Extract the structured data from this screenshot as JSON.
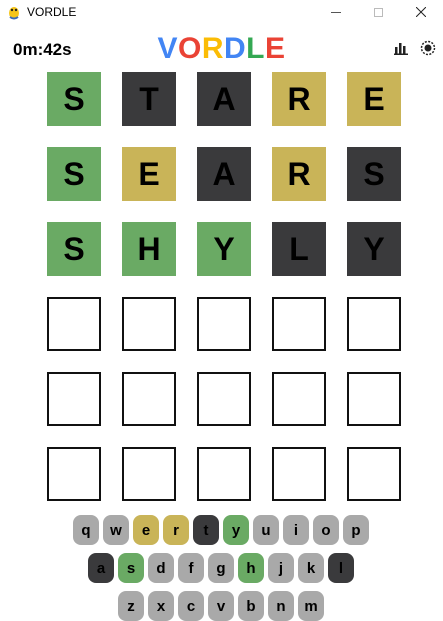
{
  "window": {
    "title": "VORDLE",
    "icon": "pygame-snake-icon"
  },
  "header": {
    "timer": "0m:42s",
    "logo_letters": [
      {
        "ch": "V",
        "color": "#4285f4"
      },
      {
        "ch": "O",
        "color": "#ea4335"
      },
      {
        "ch": "R",
        "color": "#fbbc05"
      },
      {
        "ch": "D",
        "color": "#4285f4"
      },
      {
        "ch": "L",
        "color": "#34a853"
      },
      {
        "ch": "E",
        "color": "#ea4335"
      }
    ],
    "stats_icon": "bar-chart-icon",
    "settings_icon": "gear-icon"
  },
  "board": {
    "rows": [
      [
        {
          "l": "S",
          "s": "green"
        },
        {
          "l": "T",
          "s": "gray"
        },
        {
          "l": "A",
          "s": "gray"
        },
        {
          "l": "R",
          "s": "yellow"
        },
        {
          "l": "E",
          "s": "yellow"
        }
      ],
      [
        {
          "l": "S",
          "s": "green"
        },
        {
          "l": "E",
          "s": "yellow"
        },
        {
          "l": "A",
          "s": "gray"
        },
        {
          "l": "R",
          "s": "yellow"
        },
        {
          "l": "S",
          "s": "gray"
        }
      ],
      [
        {
          "l": "S",
          "s": "green"
        },
        {
          "l": "H",
          "s": "green"
        },
        {
          "l": "Y",
          "s": "green"
        },
        {
          "l": "L",
          "s": "gray"
        },
        {
          "l": "Y",
          "s": "gray"
        }
      ],
      [
        {
          "l": "",
          "s": "empty"
        },
        {
          "l": "",
          "s": "empty"
        },
        {
          "l": "",
          "s": "empty"
        },
        {
          "l": "",
          "s": "empty"
        },
        {
          "l": "",
          "s": "empty"
        }
      ],
      [
        {
          "l": "",
          "s": "empty"
        },
        {
          "l": "",
          "s": "empty"
        },
        {
          "l": "",
          "s": "empty"
        },
        {
          "l": "",
          "s": "empty"
        },
        {
          "l": "",
          "s": "empty"
        }
      ],
      [
        {
          "l": "",
          "s": "empty"
        },
        {
          "l": "",
          "s": "empty"
        },
        {
          "l": "",
          "s": "empty"
        },
        {
          "l": "",
          "s": "empty"
        },
        {
          "l": "",
          "s": "empty"
        }
      ]
    ]
  },
  "keyboard": {
    "rows": [
      [
        {
          "k": "q",
          "s": "unused"
        },
        {
          "k": "w",
          "s": "unused"
        },
        {
          "k": "e",
          "s": "yellow"
        },
        {
          "k": "r",
          "s": "yellow"
        },
        {
          "k": "t",
          "s": "gray"
        },
        {
          "k": "y",
          "s": "green"
        },
        {
          "k": "u",
          "s": "unused"
        },
        {
          "k": "i",
          "s": "unused"
        },
        {
          "k": "o",
          "s": "unused"
        },
        {
          "k": "p",
          "s": "unused"
        }
      ],
      [
        {
          "k": "a",
          "s": "gray"
        },
        {
          "k": "s",
          "s": "green"
        },
        {
          "k": "d",
          "s": "unused"
        },
        {
          "k": "f",
          "s": "unused"
        },
        {
          "k": "g",
          "s": "unused"
        },
        {
          "k": "h",
          "s": "green"
        },
        {
          "k": "j",
          "s": "unused"
        },
        {
          "k": "k",
          "s": "unused"
        },
        {
          "k": "l",
          "s": "gray"
        }
      ],
      [
        {
          "k": "z",
          "s": "unused"
        },
        {
          "k": "x",
          "s": "unused"
        },
        {
          "k": "c",
          "s": "unused"
        },
        {
          "k": "v",
          "s": "unused"
        },
        {
          "k": "b",
          "s": "unused"
        },
        {
          "k": "n",
          "s": "unused"
        },
        {
          "k": "m",
          "s": "unused"
        }
      ]
    ]
  },
  "colors": {
    "green": "#6aaa64",
    "yellow": "#c9b458",
    "gray": "#3a3a3c",
    "unused_key": "#a9a9a9"
  }
}
